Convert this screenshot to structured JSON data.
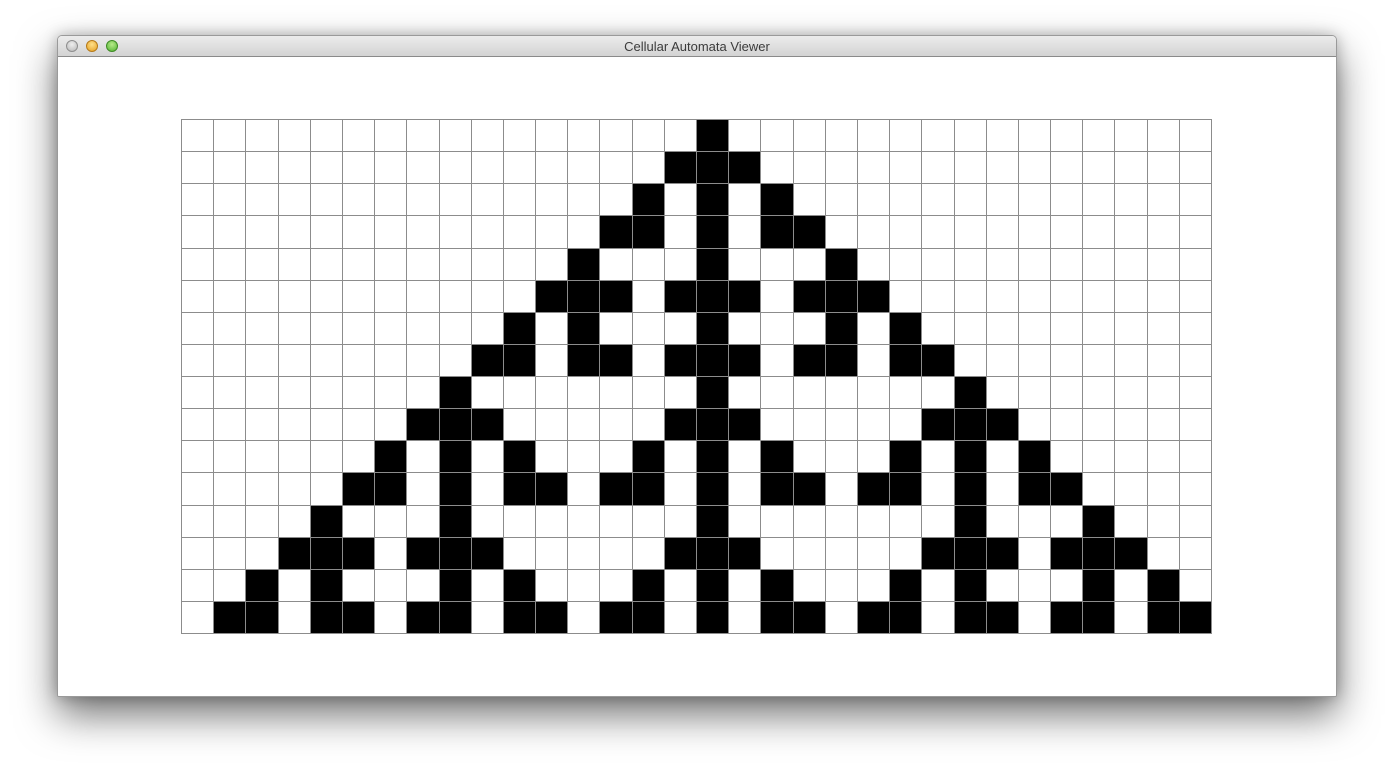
{
  "window": {
    "title": "Cellular Automata Viewer"
  },
  "automaton": {
    "rows": 16,
    "cols": 32,
    "alive_color": "#000000",
    "dead_color": "#ffffff",
    "grid_line_color": "#8c8c8c",
    "cells": [
      "................#...............",
      "...............###..............",
      "..............#.#.#.............",
      ".............##.#.##............",
      "............#...#...#...........",
      "...........###.###.###..........",
      "..........#.#...#...#.#.........",
      ".........##.##.###.##.##........",
      "........#.......#.......#.......",
      ".......###.....###.....###......",
      "......#.#.#...#.#.#...#.#.#.....",
      ".....##.#.##.##.#.##.##.#.##....",
      "....#...#.......#.......#...#...",
      "...###.###.....###.....###.###..",
      "..#.#...#.#...#.#.#...#.#...#.#.",
      ".##.##.##.##.##.#.##.##.##.##.##"
    ]
  }
}
